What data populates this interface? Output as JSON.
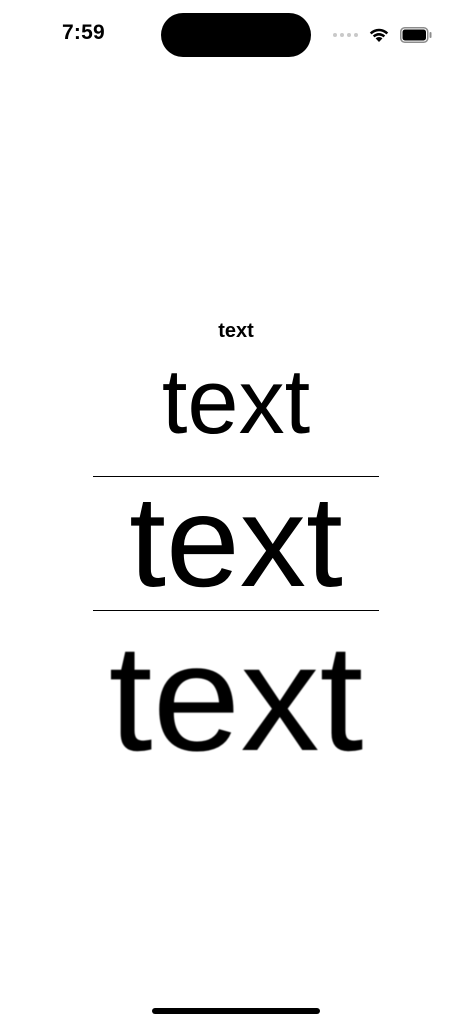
{
  "status_bar": {
    "time": "7:59",
    "icons": [
      "signal-dots-icon",
      "wifi-icon",
      "battery-icon"
    ]
  },
  "main": {
    "labels": [
      {
        "text": "text",
        "style": "bold-small"
      },
      {
        "text": "text",
        "style": "regular-medium"
      },
      {
        "text": "text",
        "style": "regular-large"
      },
      {
        "text": "text",
        "style": "regular-xlarge-blurred"
      }
    ]
  },
  "colors": {
    "background": "#ffffff",
    "text": "#000000",
    "inactive_signal": "#c9c9c9"
  }
}
